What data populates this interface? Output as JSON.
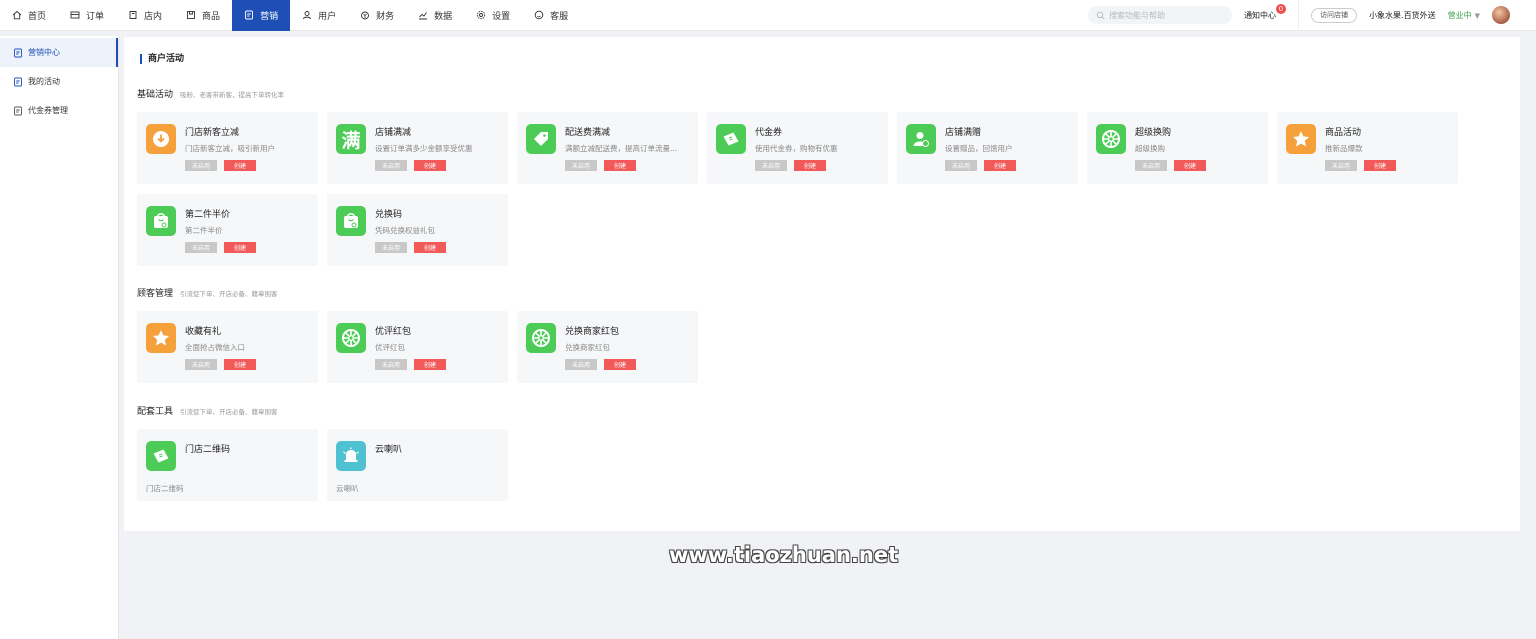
{
  "nav": {
    "items": [
      {
        "label": "首页",
        "icon": "home-icon"
      },
      {
        "label": "订单",
        "icon": "order-icon"
      },
      {
        "label": "店内",
        "icon": "store-icon"
      },
      {
        "label": "商品",
        "icon": "goods-icon"
      },
      {
        "label": "营销",
        "icon": "marketing-icon",
        "active": true
      },
      {
        "label": "用户",
        "icon": "user-icon"
      },
      {
        "label": "财务",
        "icon": "finance-icon"
      },
      {
        "label": "数据",
        "icon": "chart-icon"
      },
      {
        "label": "设置",
        "icon": "gear-icon"
      },
      {
        "label": "客服",
        "icon": "chat-icon"
      }
    ],
    "search_placeholder": "搜索功能与帮助",
    "notify_label": "通知中心",
    "notify_count": "0",
    "visit_label": "访问店铺",
    "store_name": "小象水果.百货外送",
    "status": "营业中"
  },
  "sidebar": {
    "items": [
      {
        "label": "营销中心",
        "active": true
      },
      {
        "label": "我的活动"
      },
      {
        "label": "代金券管理"
      }
    ]
  },
  "main": {
    "title": "商户活动",
    "buttons": {
      "off": "未启用",
      "create": "创建"
    },
    "sections": [
      {
        "name": "基础活动",
        "desc": "吸粉、老客带新客，提高下单转化率",
        "cards": [
          {
            "title": "门店新客立减",
            "desc": "门店新客立减，吸引新用户",
            "color": "#f5a03a",
            "icon": "download-icon"
          },
          {
            "title": "店铺满减",
            "desc": "设置订单满多少金额享受优惠",
            "color": "#4ccc57",
            "icon": "man-text-icon",
            "icon_text": "满"
          },
          {
            "title": "配送费满减",
            "desc": "满额立减配送费，提高订单流量...",
            "color": "#4ccc57",
            "icon": "tag-icon"
          },
          {
            "title": "代金券",
            "desc": "使用代金券，购物有优惠",
            "color": "#4ccc57",
            "icon": "ticket-icon"
          },
          {
            "title": "店铺满赠",
            "desc": "设置赠品，回馈用户",
            "color": "#4ccc57",
            "icon": "gift-user-icon"
          },
          {
            "title": "超级换购",
            "desc": "超级换购",
            "color": "#4ccc57",
            "icon": "wheel-icon"
          },
          {
            "title": "商品活动",
            "desc": "推新品爆款",
            "color": "#f5a03a",
            "icon": "star-icon"
          },
          {
            "title": "第二件半价",
            "desc": "第二件半价",
            "color": "#4ccc57",
            "icon": "bag-icon"
          },
          {
            "title": "兑换码",
            "desc": "凭码兑换权益礼包",
            "color": "#4ccc57",
            "icon": "bag-icon"
          }
        ]
      },
      {
        "name": "顾客管理",
        "desc": "引流促下单、开店必备、籍章围客",
        "cards": [
          {
            "title": "收藏有礼",
            "desc": "全面抢占微信入口",
            "color": "#f5a03a",
            "icon": "star-icon"
          },
          {
            "title": "优评红包",
            "desc": "优评红包",
            "color": "#4ccc57",
            "icon": "wheel-icon"
          },
          {
            "title": "兑换商家红包",
            "desc": "兑换商家红包",
            "color": "#4ccc57",
            "icon": "wheel-icon"
          }
        ]
      },
      {
        "name": "配套工具",
        "desc": "引流促下单、开店必备、籍章围客",
        "cards": [
          {
            "title": "门店二维码",
            "desc": "门店二维码",
            "color": "#4ccc57",
            "icon": "ticket-icon"
          },
          {
            "title": "云喇叭",
            "desc": "云喇叭",
            "color": "#4fc1d0",
            "icon": "bell-icon"
          }
        ]
      }
    ]
  },
  "watermark": "www.tiaozhuan.net"
}
